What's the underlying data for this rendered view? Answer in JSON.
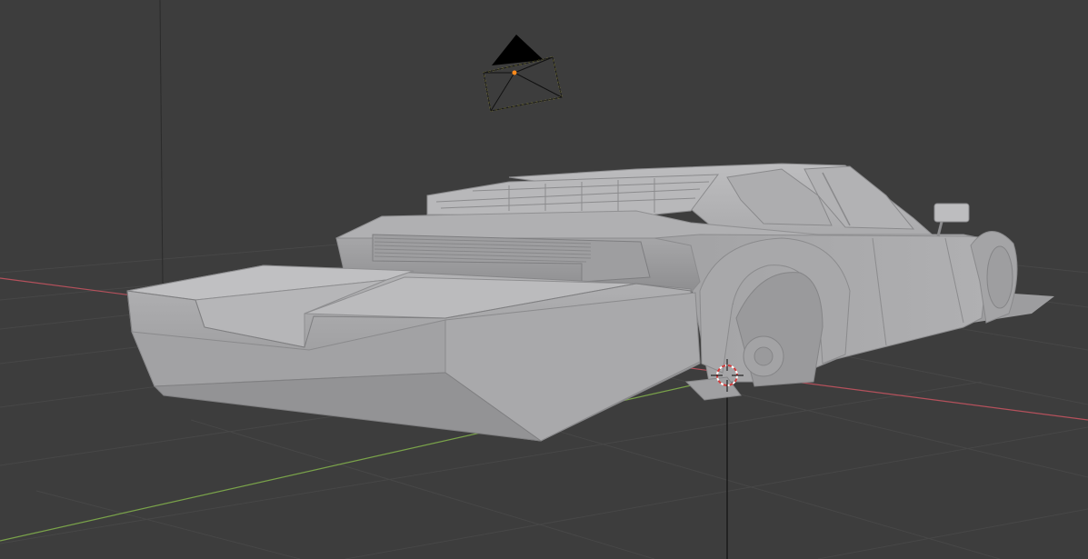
{
  "viewport": {
    "mode": "3d-viewport",
    "shading": "solid",
    "background_color": "#3d3d3d",
    "grid_color": "#474747",
    "axis_x_color": "#b5515c",
    "axis_y_color": "#7aa34a",
    "selection_outline_color": "#e9e24a"
  },
  "scene": {
    "objects": [
      {
        "name": "camera",
        "type": "camera",
        "selected": true,
        "icon": "camera-icon"
      },
      {
        "name": "car-body",
        "type": "mesh",
        "selected": false,
        "icon": "mesh-icon",
        "color": "#a9a9ab"
      },
      {
        "name": "3d-cursor",
        "type": "cursor",
        "icon": "crosshair-icon"
      }
    ]
  }
}
